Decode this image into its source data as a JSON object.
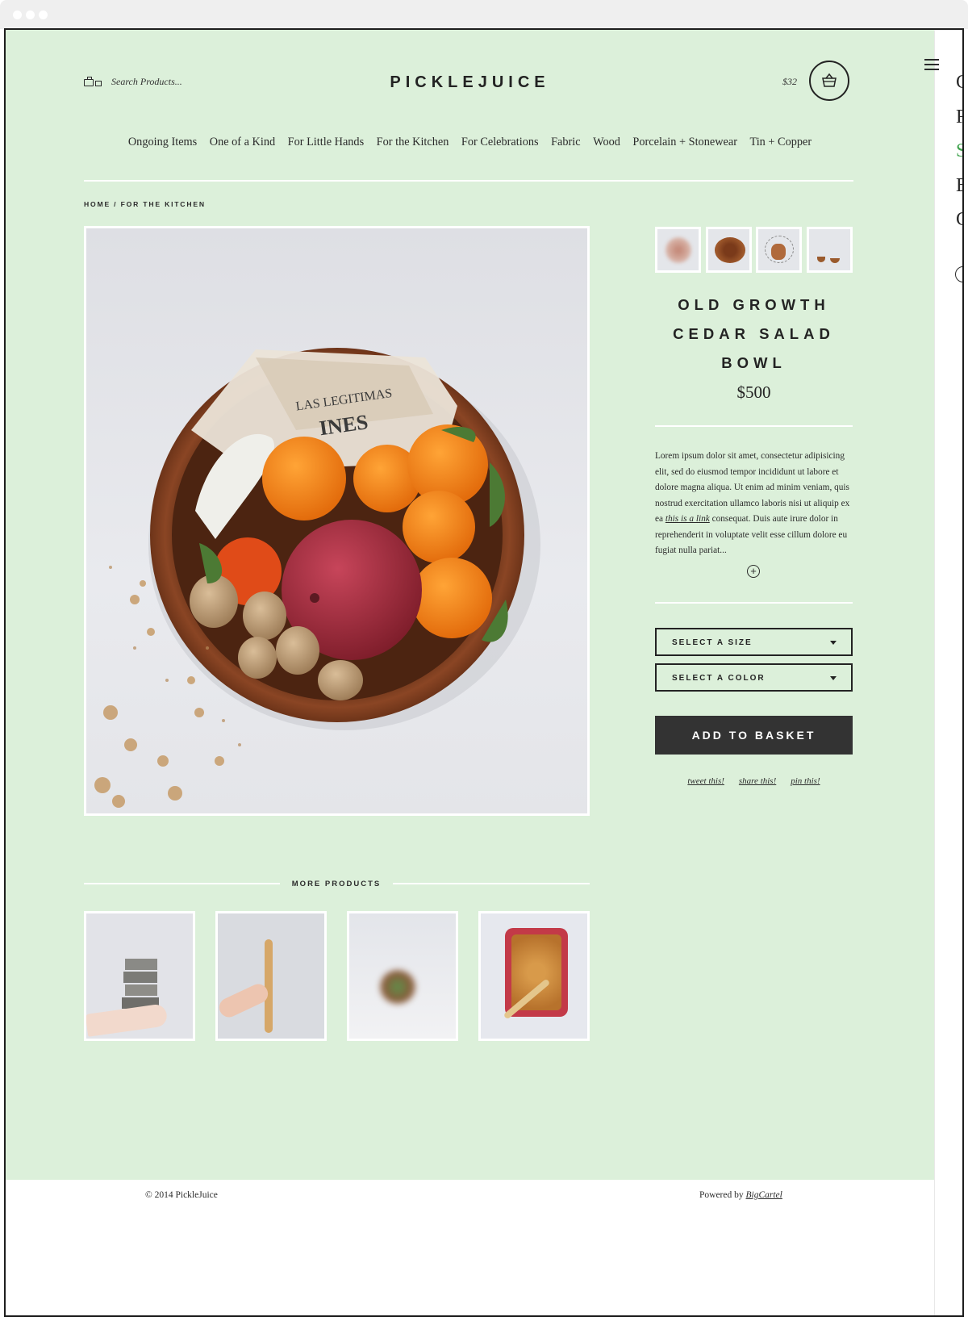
{
  "header": {
    "search_placeholder": "Search Products...",
    "brand": "PICKLEJUICE",
    "cart_total": "$32"
  },
  "nav": [
    "Ongoing Items",
    "One of a Kind",
    "For Little Hands",
    "For the Kitchen",
    "For Celebrations",
    "Fabric",
    "Wood",
    "Porcelain + Stonewear",
    "Tin + Copper"
  ],
  "breadcrumb": {
    "home": "HOME",
    "separator": " / ",
    "current": "FOR THE KITCHEN"
  },
  "product": {
    "title": "OLD GROWTH CEDAR SALAD BOWL",
    "price": "$500",
    "description_before_link": "Lorem ipsum dolor sit amet, consectetur adipisicing elit, sed do eiusmod tempor incididunt ut labore et dolore magna aliqua. Ut enim ad minim veniam, quis nostrud exercitation ullamco laboris nisi ut aliquip ex ea ",
    "description_link": "this is a link",
    "description_after_link": " consequat. Duis aute irure dolor in reprehenderit in voluptate velit esse cillum dolore eu fugiat nulla pariat...",
    "expand_symbol": "+",
    "size_select": "SELECT A SIZE",
    "color_select": "SELECT A COLOR",
    "add_button": "ADD TO BASKET",
    "share": {
      "tweet": "tweet this!",
      "share": "share this!",
      "pin": "pin this!"
    }
  },
  "more_products": {
    "title": "MORE PRODUCTS"
  },
  "footer": {
    "copyright": "© 2014 PickleJuice",
    "powered_prefix": "Powered by ",
    "powered_link": "BigCartel"
  },
  "drawer": {
    "peek_letters": [
      "C",
      "F",
      "S",
      "B",
      "C"
    ]
  },
  "colors": {
    "page_background": "#dcf0da",
    "button_dark": "#333333",
    "accent_green": "#3fa34d",
    "text": "#2b2b2b"
  },
  "icons": [
    "search-icon",
    "basket-icon",
    "hamburger-menu-icon",
    "plus-circle-icon",
    "chevron-down-icon"
  ]
}
